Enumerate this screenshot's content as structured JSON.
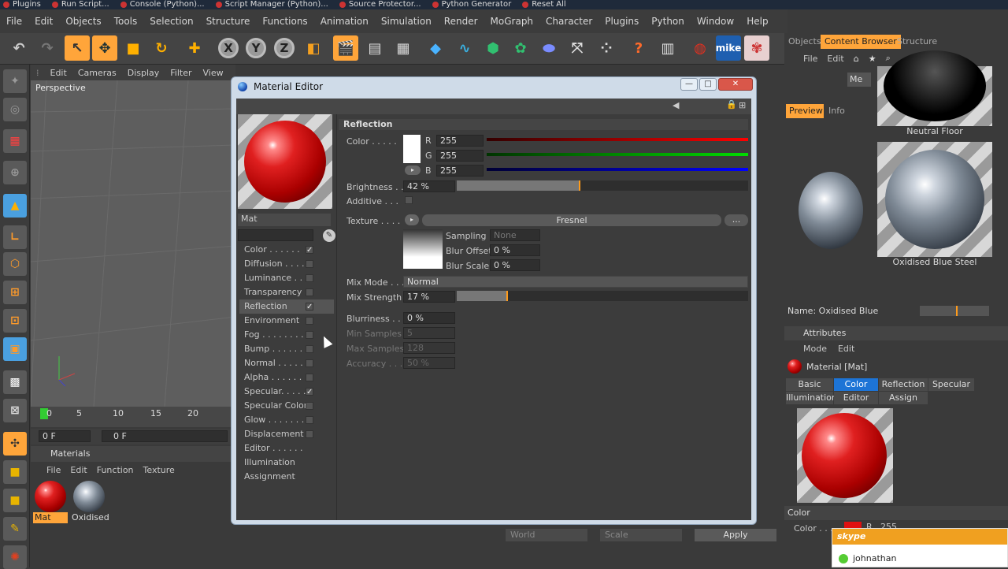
{
  "os_tabs": [
    "Plugins",
    "Run Script...",
    "Console (Python)...",
    "Script Manager (Python)...",
    "Source Protector...",
    "Python Generator",
    "Reset All"
  ],
  "menu": [
    "File",
    "Edit",
    "Objects",
    "Tools",
    "Selection",
    "Structure",
    "Functions",
    "Animation",
    "Simulation",
    "Render",
    "MoGraph",
    "Character",
    "Plugins",
    "Python",
    "Window",
    "Help"
  ],
  "toolbar": {
    "x_label": "X",
    "y_label": "Y",
    "z_label": "Z",
    "mike_label": "mike"
  },
  "viewport": {
    "menu": [
      "Edit",
      "Cameras",
      "Display",
      "Filter",
      "View"
    ],
    "name": "Perspective"
  },
  "timeline": {
    "ticks": [
      "0",
      "5",
      "10",
      "15",
      "20"
    ],
    "frame_a": "0 F",
    "frame_b": "0 F"
  },
  "materials": {
    "title": "Materials",
    "menu": [
      "File",
      "Edit",
      "Function",
      "Texture"
    ],
    "items": [
      "Mat",
      "Oxidised"
    ]
  },
  "editor": {
    "title": "Material Editor",
    "name": "Mat",
    "channels": [
      {
        "label": "Color . . . . . .",
        "checked": "✓"
      },
      {
        "label": "Diffusion . . . .",
        "checked": ""
      },
      {
        "label": "Luminance . . .",
        "checked": ""
      },
      {
        "label": "Transparency",
        "checked": ""
      },
      {
        "label": "Reflection",
        "checked": "✓"
      },
      {
        "label": "Environment",
        "checked": ""
      },
      {
        "label": "Fog . . . . . . . .",
        "checked": ""
      },
      {
        "label": "Bump . . . . . .",
        "checked": ""
      },
      {
        "label": "Normal . . . . .",
        "checked": ""
      },
      {
        "label": "Alpha . . . . . .",
        "checked": ""
      },
      {
        "label": "Specular. . . . .",
        "checked": "✓"
      },
      {
        "label": "Specular Color",
        "checked": ""
      },
      {
        "label": "Glow . . . . . . .",
        "checked": ""
      },
      {
        "label": "Displacement",
        "checked": ""
      },
      {
        "label": "Editor . . . . . .",
        "checked": ""
      },
      {
        "label": "Illumination",
        "checked": ""
      },
      {
        "label": "Assignment",
        "checked": ""
      }
    ],
    "section": "Reflection",
    "color_label": "Color . . . . .",
    "r_label": "R",
    "g_label": "G",
    "b_label": "B",
    "r": "255",
    "g": "255",
    "b": "255",
    "brightness_label": "Brightness . .",
    "brightness": "42 %",
    "brightness_level": 0.42,
    "additive_label": "Additive . . .",
    "texture_label": "Texture . . . .",
    "texture": "Fresnel",
    "texture_more": "...",
    "sampling_label": "Sampling",
    "sampling": "None",
    "blur_offset_label": "Blur Offset",
    "blur_offset": "0 %",
    "blur_scale_label": "Blur Scale",
    "blur_scale": "0 %",
    "mix_mode_label": "Mix Mode . . .",
    "mix_mode": "Normal",
    "mix_strength_label": "Mix Strength",
    "mix_strength": "17 %",
    "mix_level": 0.17,
    "blurriness_label": "Blurriness . . .",
    "blurriness": "0 %",
    "min_samples_label": "Min Samples",
    "min_samples": "5",
    "max_samples_label": "Max Samples",
    "max_samples": "128",
    "accuracy_label": "Accuracy . . .",
    "accuracy": "50 %"
  },
  "right": {
    "tabs": [
      "Objects",
      "Content Browser",
      "Structure"
    ],
    "menu": [
      "File",
      "Edit"
    ],
    "me_label": "Me",
    "preview_tab": "Preview",
    "info_tab": "Info",
    "thumb1": "Neutral Floor",
    "thumb2": "Oxidised Blue Steel",
    "name_label": "Name:",
    "name_value": "Oxidised Blue",
    "attributes": "Attributes",
    "attr_menu": [
      "Mode",
      "Edit"
    ],
    "material_title": "Material [Mat]",
    "attr_tabs_row1": [
      "Basic",
      "Color",
      "Reflection",
      "Specular"
    ],
    "attr_tabs_row2": [
      "Illumination",
      "Editor",
      "Assign"
    ],
    "color_section": "Color",
    "color_field_label": "Color . . . .",
    "color_r": "R",
    "color_r_value": "255",
    "bottom": {
      "world": "World",
      "scale": "Scale",
      "apply": "Apply"
    }
  },
  "skype": {
    "brand": "skype",
    "user": "johnathan"
  },
  "colors": {
    "accent": "#ff9b1a",
    "active_tab": "#1d74d6",
    "window_frame": "#cfdbe8"
  }
}
